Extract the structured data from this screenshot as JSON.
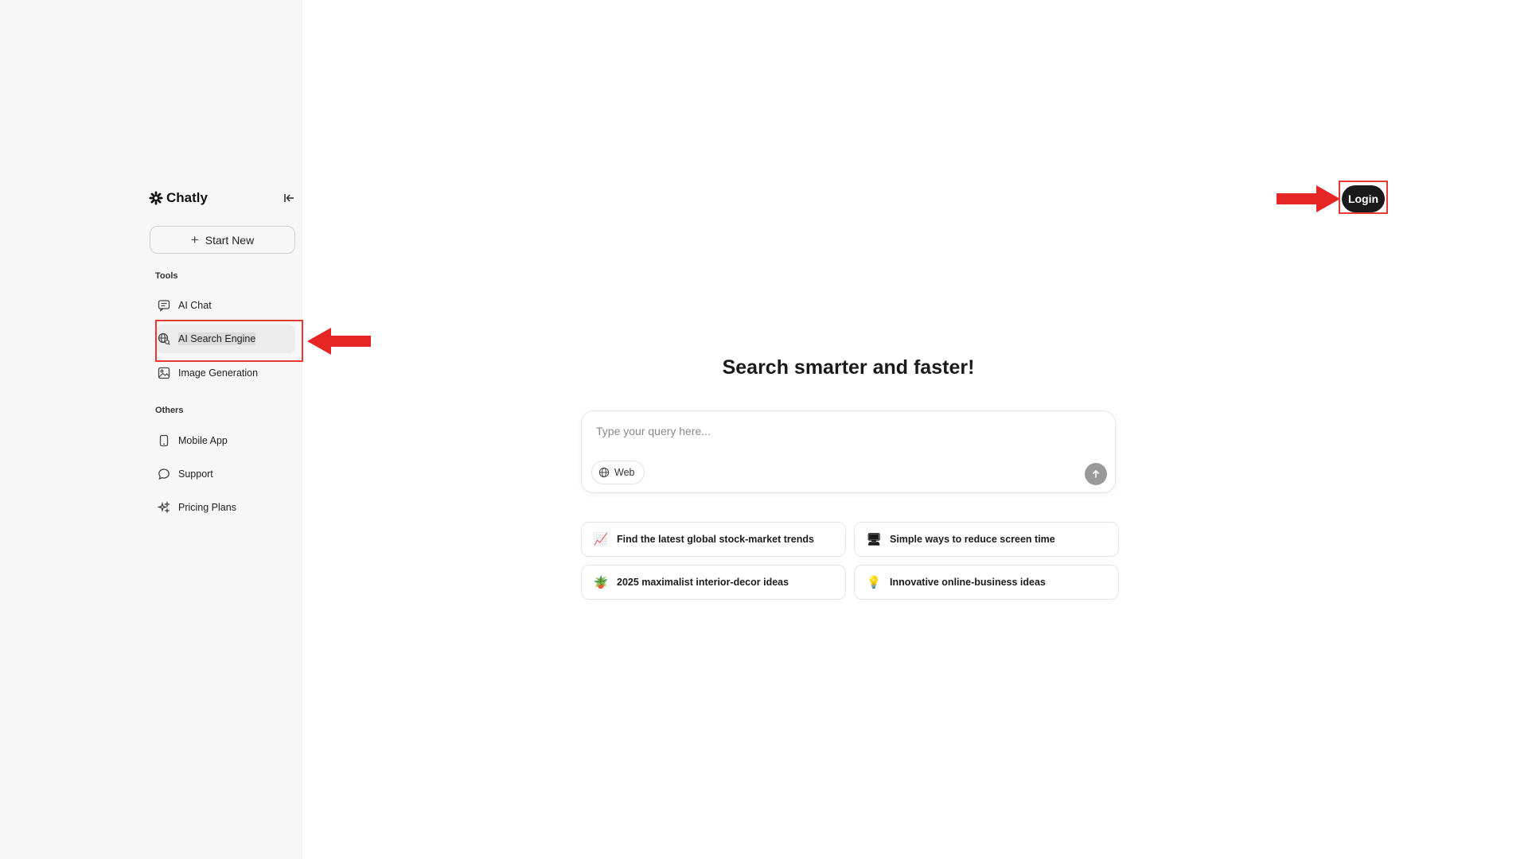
{
  "app": {
    "brand": "Chatly"
  },
  "sidebar": {
    "start_new_label": "Start New",
    "tools_heading": "Tools",
    "tools": [
      {
        "label": "AI Chat",
        "icon": "chat-bubble-icon"
      },
      {
        "label": "AI Search Engine",
        "icon": "globe-search-icon",
        "active": true
      },
      {
        "label": "Image Generation",
        "icon": "image-icon"
      }
    ],
    "others_heading": "Others",
    "others": [
      {
        "label": "Mobile App",
        "icon": "phone-icon"
      },
      {
        "label": "Support",
        "icon": "speech-bubble-icon"
      },
      {
        "label": "Pricing Plans",
        "icon": "sparkles-icon"
      }
    ]
  },
  "header": {
    "login_label": "Login"
  },
  "main": {
    "headline": "Search smarter and faster!",
    "search": {
      "placeholder": "Type your query here...",
      "value": "",
      "mode_label": "Web"
    },
    "suggestions": [
      {
        "emoji": "📈",
        "label": "Find the latest global stock-market trends"
      },
      {
        "emoji": "🖥",
        "label": "Simple ways to reduce screen time"
      },
      {
        "emoji": "🪴",
        "label": "2025 maximalist interior-decor ideas"
      },
      {
        "emoji": "💡",
        "label": "Innovative online-business ideas"
      }
    ]
  },
  "annotations": {
    "highlight_color": "#e53935"
  }
}
